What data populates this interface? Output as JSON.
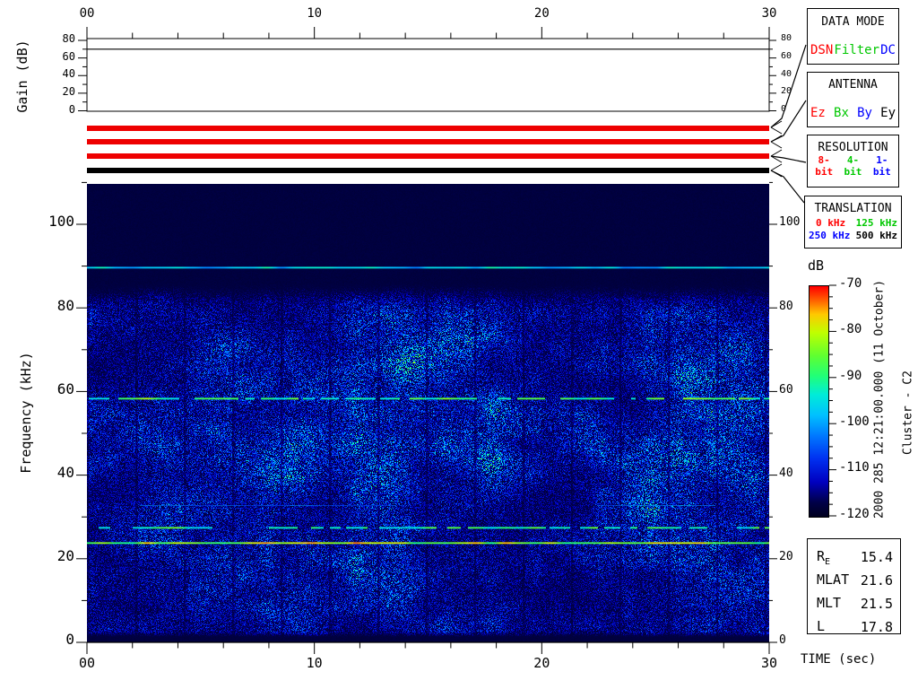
{
  "window": {
    "background": "#ffffff"
  },
  "top_axis": {
    "tick_labels": [
      "00",
      "10",
      "20",
      "30"
    ]
  },
  "gain_panel": {
    "ylabel": "Gain (dB)",
    "ytick_labels": [
      "80",
      "60",
      "40",
      "20",
      "0"
    ],
    "ytick_values": [
      80,
      60,
      40,
      20,
      0
    ]
  },
  "status_bars": [
    {
      "name": "data-mode-bar",
      "color": "#ee0000"
    },
    {
      "name": "antenna-bar",
      "color": "#ee0000"
    },
    {
      "name": "resolution-bar",
      "color": "#ee0000"
    },
    {
      "name": "translation-bar",
      "color": "#000000"
    }
  ],
  "info_boxes": {
    "data_mode": {
      "title": "DATA MODE",
      "items": [
        {
          "label": "DSN",
          "color": "#ff0000"
        },
        {
          "label": "Filter",
          "color": "#00c800"
        },
        {
          "label": "DC",
          "color": "#0000ff"
        }
      ]
    },
    "antenna": {
      "title": "ANTENNA",
      "items": [
        {
          "label": "Ez",
          "color": "#ff0000"
        },
        {
          "label": "Bx",
          "color": "#00c800"
        },
        {
          "label": "By",
          "color": "#0000ff"
        },
        {
          "label": "Ey",
          "color": "#000000"
        }
      ]
    },
    "resolution": {
      "title": "RESOLUTION",
      "items": [
        {
          "label": "8-bit",
          "color": "#ff0000"
        },
        {
          "label": "4-bit",
          "color": "#00c800"
        },
        {
          "label": "1-bit",
          "color": "#0000ff"
        }
      ]
    },
    "translation": {
      "title": "TRANSLATION",
      "rows": [
        [
          {
            "label": "0 kHz",
            "color": "#ff0000"
          },
          {
            "label": "125 kHz",
            "color": "#00c800"
          }
        ],
        [
          {
            "label": "250 kHz",
            "color": "#0000ff"
          },
          {
            "label": "500 kHz",
            "color": "#000000"
          }
        ]
      ]
    }
  },
  "colorbar": {
    "title": "dB",
    "tick_labels": [
      "-70",
      "-80",
      "-90",
      "-100",
      "-110",
      "-120"
    ],
    "tick_values": [
      -70,
      -80,
      -90,
      -100,
      -110,
      -120
    ],
    "minor_ticks_per_interval": 3,
    "gradient_stops": [
      {
        "p": 0.0,
        "color": "#000020"
      },
      {
        "p": 0.06,
        "color": "#000048"
      },
      {
        "p": 0.15,
        "color": "#0000c0"
      },
      {
        "p": 0.25,
        "color": "#0030f0"
      },
      {
        "p": 0.35,
        "color": "#0078ff"
      },
      {
        "p": 0.44,
        "color": "#00c0ff"
      },
      {
        "p": 0.53,
        "color": "#00ecd8"
      },
      {
        "p": 0.61,
        "color": "#20ff78"
      },
      {
        "p": 0.7,
        "color": "#60ff30"
      },
      {
        "p": 0.8,
        "color": "#c0ff00"
      },
      {
        "p": 0.88,
        "color": "#ffc800"
      },
      {
        "p": 0.94,
        "color": "#ff6000"
      },
      {
        "p": 1.0,
        "color": "#ff0000"
      }
    ]
  },
  "side_annotations": {
    "datetime": "2000 285 12:21:00.000 (11 October)",
    "spacecraft": "Cluster - C2"
  },
  "ephemeris": {
    "rows": [
      {
        "label": "R",
        "sub": "E",
        "value": "15.4"
      },
      {
        "label": "MLAT",
        "sub": "",
        "value": "21.6"
      },
      {
        "label": "MLT",
        "sub": "",
        "value": "21.5"
      },
      {
        "label": "L",
        "sub": "",
        "value": "17.8"
      }
    ]
  },
  "bottom_axis": {
    "label": "TIME (sec)",
    "tick_labels": [
      "00",
      "10",
      "20",
      "30"
    ]
  },
  "freq_axis": {
    "ylabel": "Frequency (kHz)",
    "ytick_labels": [
      "100",
      "80",
      "60",
      "40",
      "20",
      "0"
    ],
    "ytick_values": [
      100,
      80,
      60,
      40,
      20,
      0
    ]
  },
  "chart_data": [
    {
      "type": "line",
      "name": "receiver-gain-panel",
      "ylabel": "Gain (dB)",
      "ylim": [
        0,
        80
      ],
      "yticks": [
        0,
        20,
        40,
        60,
        80
      ],
      "x_range_sec": [
        0,
        30
      ],
      "x_major_ticks": [
        0,
        10,
        20,
        30
      ],
      "x_minor_step_sec": 2,
      "series": [
        {
          "name": "receiver-gain",
          "x_sec": [
            0,
            30
          ],
          "values_db": [
            70,
            70
          ]
        }
      ]
    },
    {
      "type": "heatmap",
      "name": "wbd-spectrogram",
      "xlabel": "TIME (sec)",
      "ylabel": "Frequency (kHz)",
      "x_range_sec": [
        0,
        30
      ],
      "x_major_ticks": [
        0,
        10,
        20,
        30
      ],
      "x_minor_step_sec": 2,
      "y_range_khz": [
        0,
        110
      ],
      "y_major_ticks": [
        0,
        20,
        40,
        60,
        80,
        100
      ],
      "y_minor_step_khz": 10,
      "z_label": "dB",
      "z_range_db": [
        -120,
        -70
      ],
      "colormap": "rainbow",
      "background_level_db": -119,
      "quiet_region_khz": [
        92,
        110
      ],
      "broadband_noise": {
        "freq_range_khz": [
          1.5,
          86
        ],
        "typical_level_db": [
          -116,
          -103
        ],
        "patch_peak_db": -94,
        "vertical_striations": true,
        "striation_period_sec": 2.1
      },
      "spectral_lines": [
        {
          "freq_khz": 90,
          "level_db": -96,
          "style": "solid",
          "appearance": "cyan"
        },
        {
          "freq_khz": 58.5,
          "level_db": -88,
          "style": "dashed",
          "appearance": "green"
        },
        {
          "freq_khz": 33,
          "level_db": -101,
          "style": "intermittent",
          "appearance": "faint-cyan",
          "time_ranges_sec": [
            [
              2.3,
              13.6
            ],
            [
              22.4,
              27.6
            ]
          ]
        },
        {
          "freq_khz": 27.5,
          "level_db": -89,
          "style": "dashed",
          "appearance": "green"
        },
        {
          "freq_khz": 24,
          "level_db": -81,
          "style": "solid",
          "appearance": "yellow-green"
        }
      ],
      "enhancements": [
        {
          "t_sec": 11.0,
          "f_khz": 63,
          "dt": 1.8,
          "df": 5,
          "s": 0.45
        },
        {
          "t_sec": 14.0,
          "f_khz": 68,
          "dt": 1.8,
          "df": 5,
          "s": 0.5
        },
        {
          "t_sec": 16.5,
          "f_khz": 73,
          "dt": 1.5,
          "df": 4,
          "s": 0.45
        },
        {
          "t_sec": 15.8,
          "f_khz": 47,
          "dt": 1.2,
          "df": 4,
          "s": 0.5
        },
        {
          "t_sec": 8.3,
          "f_khz": 40,
          "dt": 1.5,
          "df": 6,
          "s": 0.4
        },
        {
          "t_sec": 13.0,
          "f_khz": 37,
          "dt": 1.5,
          "df": 5,
          "s": 0.35
        },
        {
          "t_sec": 18.0,
          "f_khz": 42,
          "dt": 1.3,
          "df": 5,
          "s": 0.45
        },
        {
          "t_sec": 21.5,
          "f_khz": 52,
          "dt": 1.5,
          "df": 6,
          "s": 0.35
        },
        {
          "t_sec": 26.6,
          "f_khz": 64,
          "dt": 1.2,
          "df": 5,
          "s": 0.55
        },
        {
          "t_sec": 28.8,
          "f_khz": 69,
          "dt": 1.0,
          "df": 4,
          "s": 0.45
        },
        {
          "t_sec": 24.5,
          "f_khz": 33,
          "dt": 1.5,
          "df": 5,
          "s": 0.3
        },
        {
          "t_sec": 4.5,
          "f_khz": 33,
          "dt": 2.0,
          "df": 6,
          "s": 0.3
        },
        {
          "t_sec": 2.5,
          "f_khz": 25,
          "dt": 1.5,
          "df": 5,
          "s": 0.3
        },
        {
          "t_sec": 29.3,
          "f_khz": 40,
          "dt": 1.0,
          "df": 8,
          "s": 0.35
        }
      ]
    }
  ]
}
